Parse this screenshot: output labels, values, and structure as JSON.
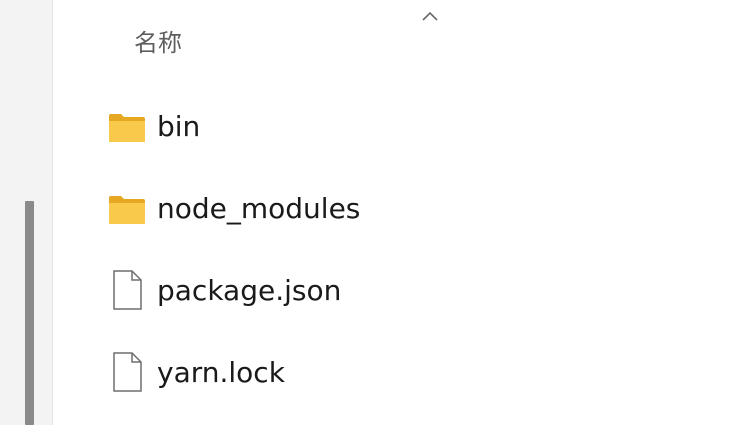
{
  "column_header": {
    "name_label": "名称"
  },
  "files": [
    {
      "name": "bin",
      "icon": "folder-icon"
    },
    {
      "name": "node_modules",
      "icon": "folder-icon"
    },
    {
      "name": "package.json",
      "icon": "file-icon"
    },
    {
      "name": "yarn.lock",
      "icon": "file-icon"
    }
  ],
  "colors": {
    "folder": "#f5c443",
    "folder_dark": "#e6a823",
    "nav_pane": "#f3f3f3",
    "scroll_thumb": "#8a8a8a",
    "text": "#1a1a1a",
    "header_text": "#5f5f5f"
  }
}
